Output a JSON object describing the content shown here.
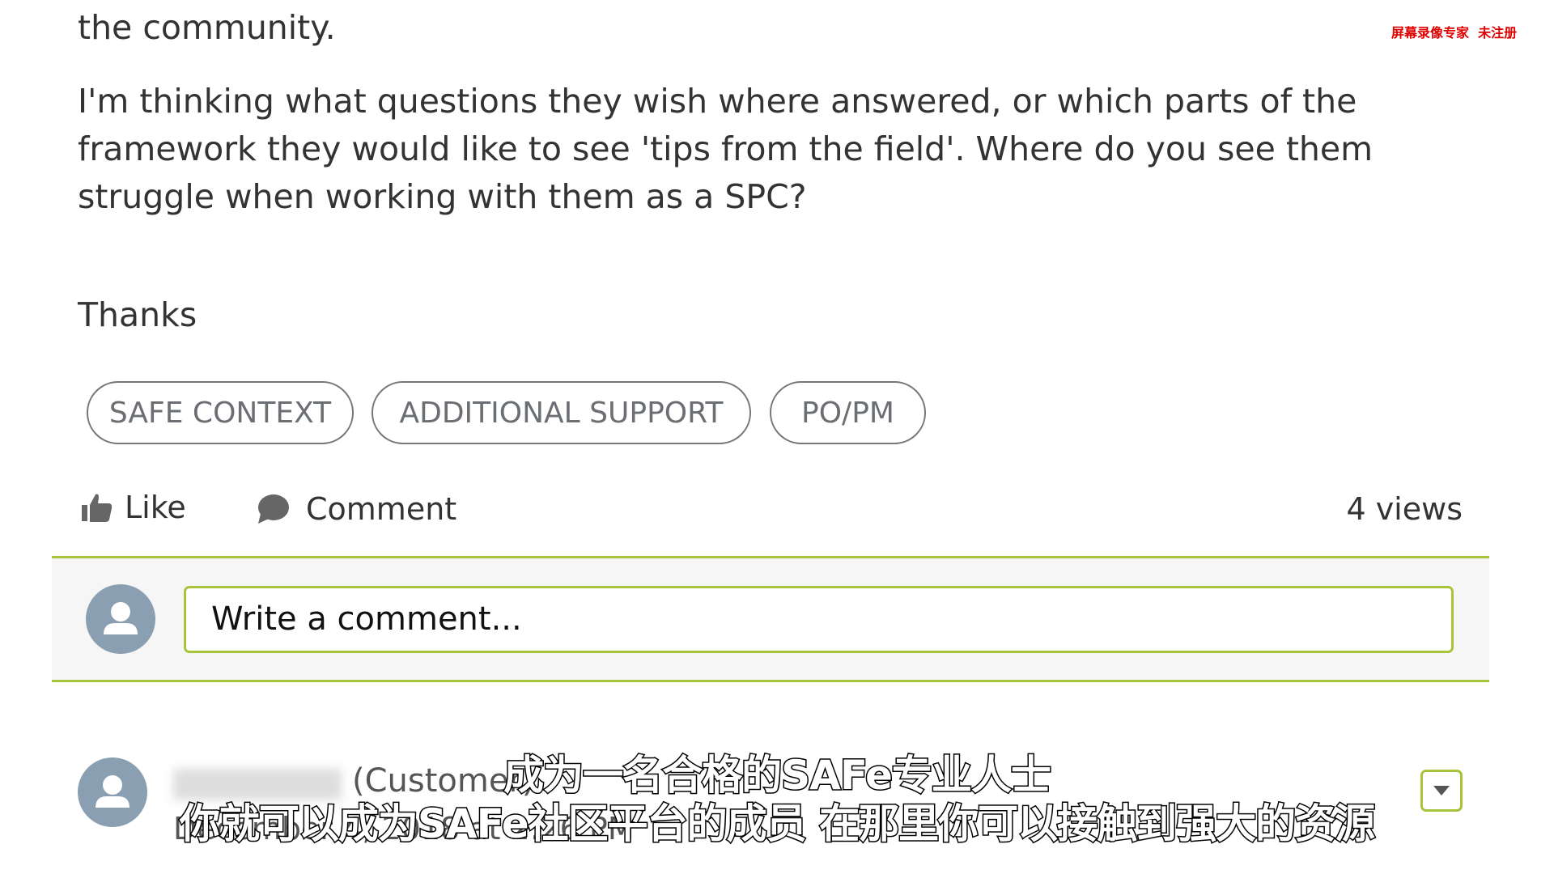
{
  "post": {
    "line_top": "the community.",
    "paragraph": "I'm thinking what questions they wish where answered, or which parts of the framework they would like to see 'tips from the field'. Where do you see them struggle when working with them as a SPC?",
    "signoff": "Thanks"
  },
  "tags": [
    "SAFE CONTEXT",
    "ADDITIONAL SUPPORT",
    "PO/PM"
  ],
  "actions": {
    "like": "Like",
    "comment": "Comment",
    "views": "4 views"
  },
  "comment_box": {
    "placeholder": "Write a comment..."
  },
  "comment": {
    "author_role": "(Customer)",
    "date": "December 4, 2018 at 2:26 PM"
  },
  "subtitles": [
    "成为一名合格的SAFe专业人士",
    "你就可以成为SAFe社区平台的成员  在那里你可以接触到强大的资源"
  ],
  "watermark": "屏幕录像专家  未注册",
  "colors": {
    "accent": "#a8c43a",
    "avatar": "#8a9fb1",
    "watermark": "#e00000"
  }
}
